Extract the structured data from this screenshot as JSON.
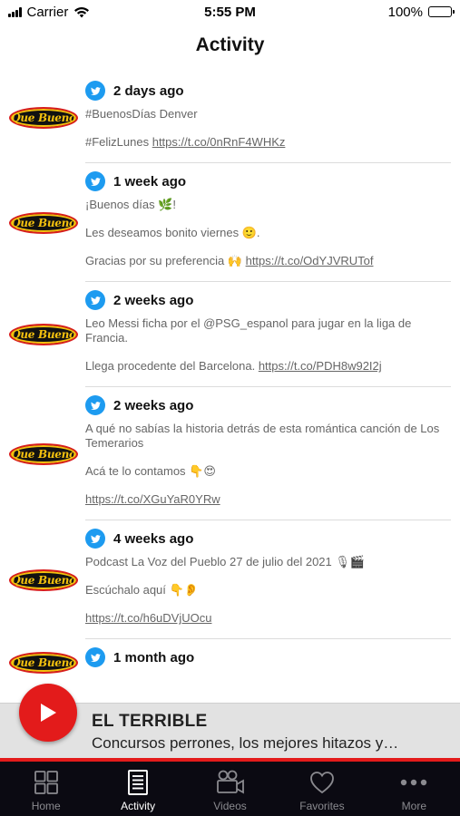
{
  "status_bar": {
    "carrier": "Carrier",
    "time": "5:55 PM",
    "battery": "100%"
  },
  "nav": {
    "title": "Activity"
  },
  "feed": {
    "logo_text": "Que Bueno",
    "items": [
      {
        "time": "2 days ago",
        "paragraphs": [
          {
            "text": "#BuenosDías Denver",
            "link": ""
          },
          {
            "text": "#FelizLunes ",
            "link": "https://t.co/0nRnF4WHKz"
          }
        ]
      },
      {
        "time": "1 week ago",
        "paragraphs": [
          {
            "text": "¡Buenos días 🌿!",
            "link": ""
          },
          {
            "text": "Les deseamos bonito viernes 🙂.",
            "link": ""
          },
          {
            "text": "Gracias por su preferencia 🙌 ",
            "link": "https://t.co/OdYJVRUTof"
          }
        ]
      },
      {
        "time": "2 weeks ago",
        "paragraphs": [
          {
            "text": "Leo Messi ficha por el @PSG_espanol para jugar en la liga de Francia.",
            "link": ""
          },
          {
            "text": "Llega procedente del Barcelona. ",
            "link": "https://t.co/PDH8w92I2j"
          }
        ]
      },
      {
        "time": "2 weeks ago",
        "paragraphs": [
          {
            "text": "A qué no sabías la historia detrás de esta romántica canción de Los Temerarios",
            "link": ""
          },
          {
            "text": "Acá te lo contamos 👇😍",
            "link": ""
          },
          {
            "text": "",
            "link": "https://t.co/XGuYaR0YRw"
          }
        ]
      },
      {
        "time": "4 weeks ago",
        "paragraphs": [
          {
            "text": "Podcast La Voz del Pueblo 27 de julio del 2021 🎙🎬",
            "link": ""
          },
          {
            "text": "Escúchalo aquí 👇👂",
            "link": ""
          },
          {
            "text": "",
            "link": "https://t.co/h6uDVjUOcu"
          }
        ]
      },
      {
        "time": "1 month ago",
        "paragraphs": []
      }
    ]
  },
  "player": {
    "title": "EL TERRIBLE",
    "subtitle": "Concursos perrones, los mejores hitazos y…"
  },
  "tabs": [
    {
      "label": "Home",
      "icon": "grid-icon",
      "active": false
    },
    {
      "label": "Activity",
      "icon": "document-icon",
      "active": true
    },
    {
      "label": "Videos",
      "icon": "video-camera-icon",
      "active": false
    },
    {
      "label": "Favorites",
      "icon": "heart-icon",
      "active": false
    },
    {
      "label": "More",
      "icon": "more-dots-icon",
      "active": false
    }
  ],
  "colors": {
    "accent_red": "#e31b1b",
    "twitter_blue": "#1d9bf0",
    "tabbar_bg": "#0b0a12",
    "player_bg": "#e2e2e2"
  }
}
